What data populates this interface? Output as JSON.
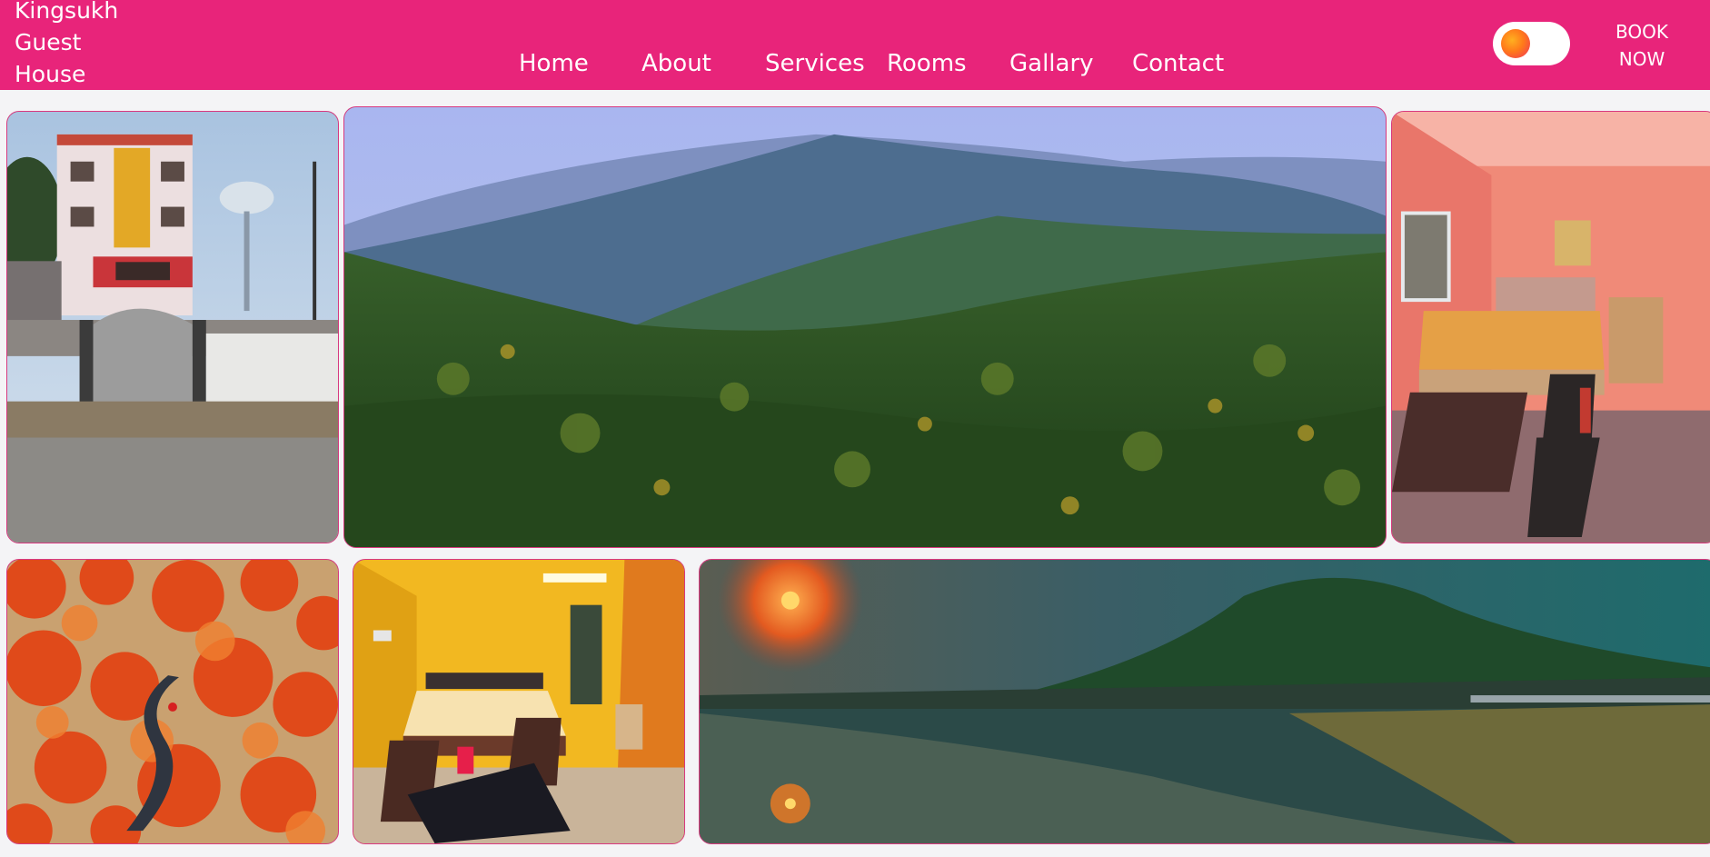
{
  "brand": {
    "line1": "Kingsukh",
    "line2": "Guest",
    "line3": "House"
  },
  "nav": {
    "home": "Home",
    "about": "About",
    "services": "Services",
    "rooms": "Rooms",
    "gallery": "Gallary",
    "contact": "Contact"
  },
  "book_button": {
    "line1": "BOOK",
    "line2": "NOW"
  },
  "theme_toggle": {
    "icon": "sun-icon"
  },
  "colors": {
    "header": "#e8247a",
    "background": "#f4f4f6",
    "tile_border": "#d8397f"
  },
  "gallery_images": [
    "guest-house-exterior",
    "forested-hills",
    "pink-bedroom",
    "flame-of-the-forest-trees",
    "yellow-bedroom",
    "sunset-lake-mountain"
  ]
}
